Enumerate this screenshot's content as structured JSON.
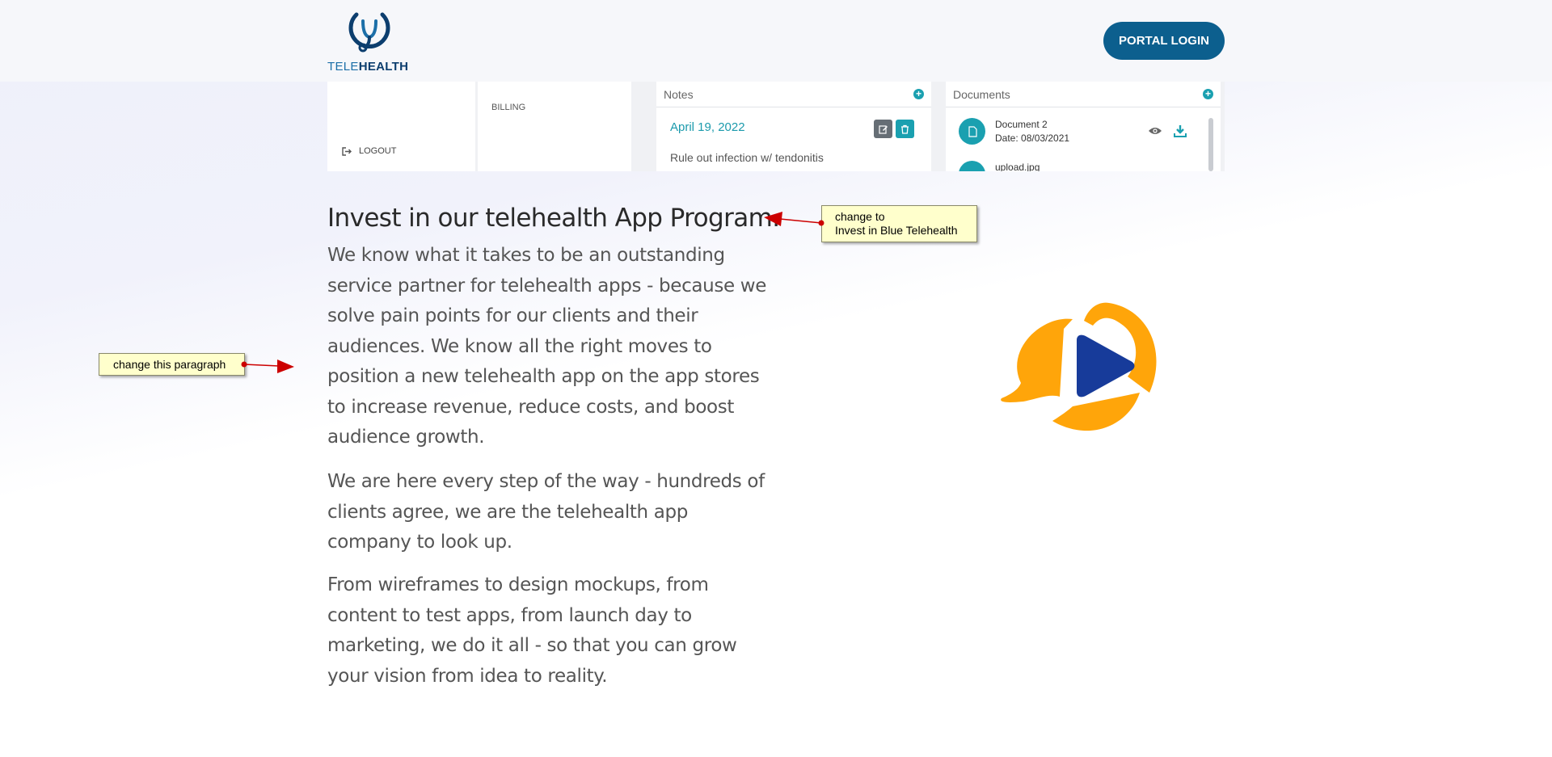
{
  "header": {
    "logo_text_tele": "TELE",
    "logo_text_health": "HEALTH",
    "portal_login_label": "PORTAL LOGIN"
  },
  "preview": {
    "logout_label": "LOGOUT",
    "billing_label": "BILLING",
    "notes": {
      "title": "Notes",
      "date": "April 19, 2022",
      "text": "Rule out infection w/ tendonitis"
    },
    "documents": {
      "title": "Documents",
      "items": [
        {
          "name": "Document 2",
          "date": "Date: 08/03/2021"
        },
        {
          "name": "upload.jpg"
        }
      ]
    }
  },
  "main": {
    "title": "Invest in our telehealth App Program.",
    "paragraphs": [
      "We know what it takes to be an outstanding service partner for telehealth apps - because we solve pain points for our clients and their audiences. We know all the right moves to position a new telehealth app on the app stores to increase revenue, reduce costs, and boost audience growth.",
      "We are here every step of the way - hundreds of clients agree, we are the telehealth app company to look up.",
      "From wireframes to design mockups, from content to test apps, from launch day to marketing, we do it all - so that you can grow your vision from idea to reality."
    ]
  },
  "annotations": {
    "title_note_line1": "change to",
    "title_note_line2": "Invest in Blue Telehealth",
    "paragraph_note": "change this paragraph"
  },
  "colors": {
    "brand_navy": "#0c3e6e",
    "button_blue": "#0c5f8e",
    "teal": "#1aa0b0",
    "logo_orange": "#ffa50a",
    "logo_blue": "#173b9a",
    "note_yellow": "#ffffcc",
    "arrow_red": "#cc0000"
  }
}
